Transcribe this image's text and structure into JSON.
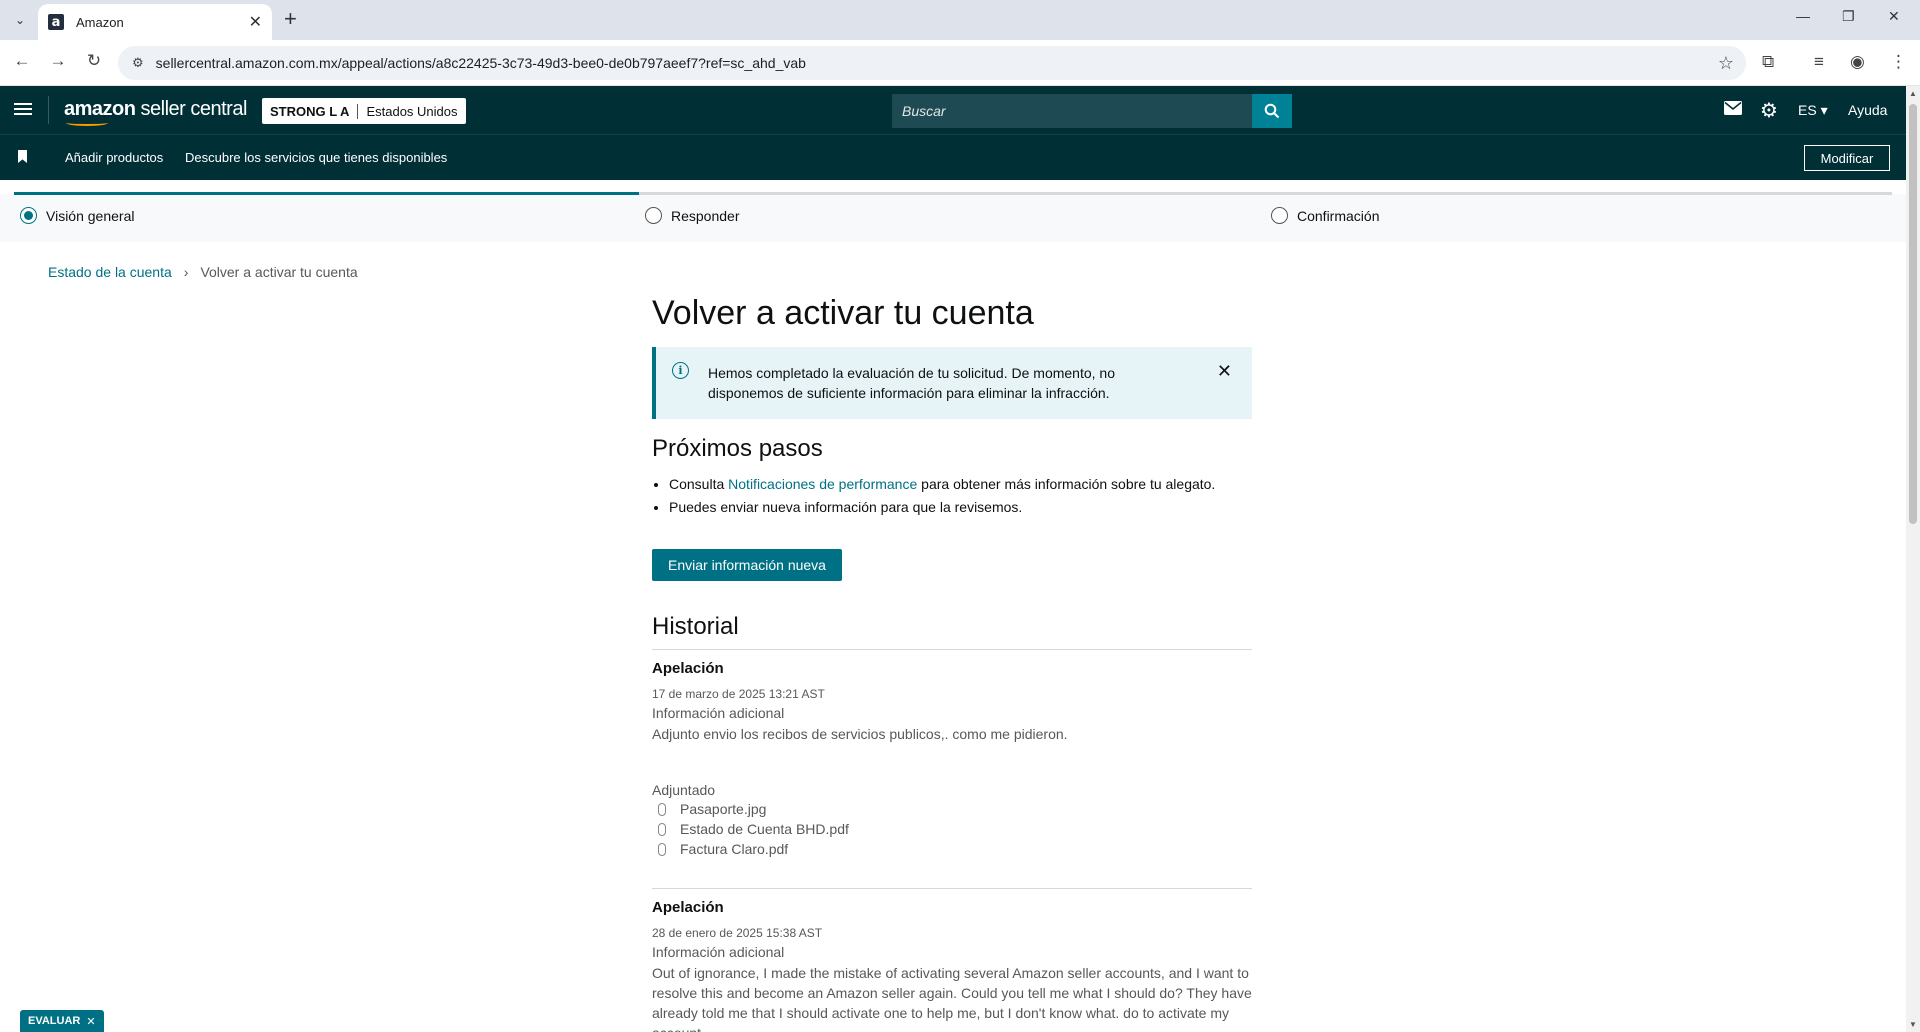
{
  "browser": {
    "tab_title": "Amazon",
    "url": "sellercentral.amazon.com.mx/appeal/actions/a8c22425-3c73-49d3-bee0-de0b797aeef7?ref=sc_ahd_vab"
  },
  "header": {
    "logo_main": "amazon",
    "logo_sub": " seller central",
    "account_name": "STRONG L A",
    "account_region": "Estados Unidos",
    "search_placeholder": "Buscar",
    "language": "ES ▾",
    "help": "Ayuda"
  },
  "subnav": {
    "add_products": "Añadir productos",
    "discover_services": "Descubre los servicios que tienes disponibles",
    "modify": "Modificar"
  },
  "stepper": {
    "progress": 0.333,
    "steps": [
      {
        "label": "Visión general",
        "active": true
      },
      {
        "label": "Responder",
        "active": false
      },
      {
        "label": "Confirmación",
        "active": false
      }
    ]
  },
  "breadcrumb": {
    "parent": "Estado de la cuenta",
    "current": "Volver a activar tu cuenta"
  },
  "main": {
    "title": "Volver a activar tu cuenta",
    "alert": "Hemos completado la evaluación de tu solicitud. De momento, no disponemos de suficiente información para eliminar la infracción.",
    "next_steps_title": "Próximos pasos",
    "step1_pre": "Consulta ",
    "step1_link": "Notificaciones de performance",
    "step1_post": " para obtener más información sobre tu alegato.",
    "step2": "Puedes enviar nueva información para que la revisemos.",
    "submit_button": "Enviar información nueva",
    "history_title": "Historial"
  },
  "history": [
    {
      "title": "Apelación",
      "date": "17 de marzo de 2025 13:21 AST",
      "label": "Información adicional",
      "text": "Adjunto envio los recibos de servicios publicos,. como me pidieron.",
      "attached_label": "Adjuntado",
      "files": [
        "Pasaporte.jpg",
        "Estado de Cuenta BHD.pdf",
        "Factura Claro.pdf"
      ]
    },
    {
      "title": "Apelación",
      "date": "28 de enero de 2025 15:38 AST",
      "label": "Información adicional",
      "text": "Out of ignorance, I made the mistake of activating several Amazon seller accounts, and I want to resolve this and become an Amazon seller again. Could you tell me what I should do? They have already told me that I should activate one to help me, but I don't know what. do to activate my account"
    }
  ],
  "eval_badge": "EVALUAR"
}
